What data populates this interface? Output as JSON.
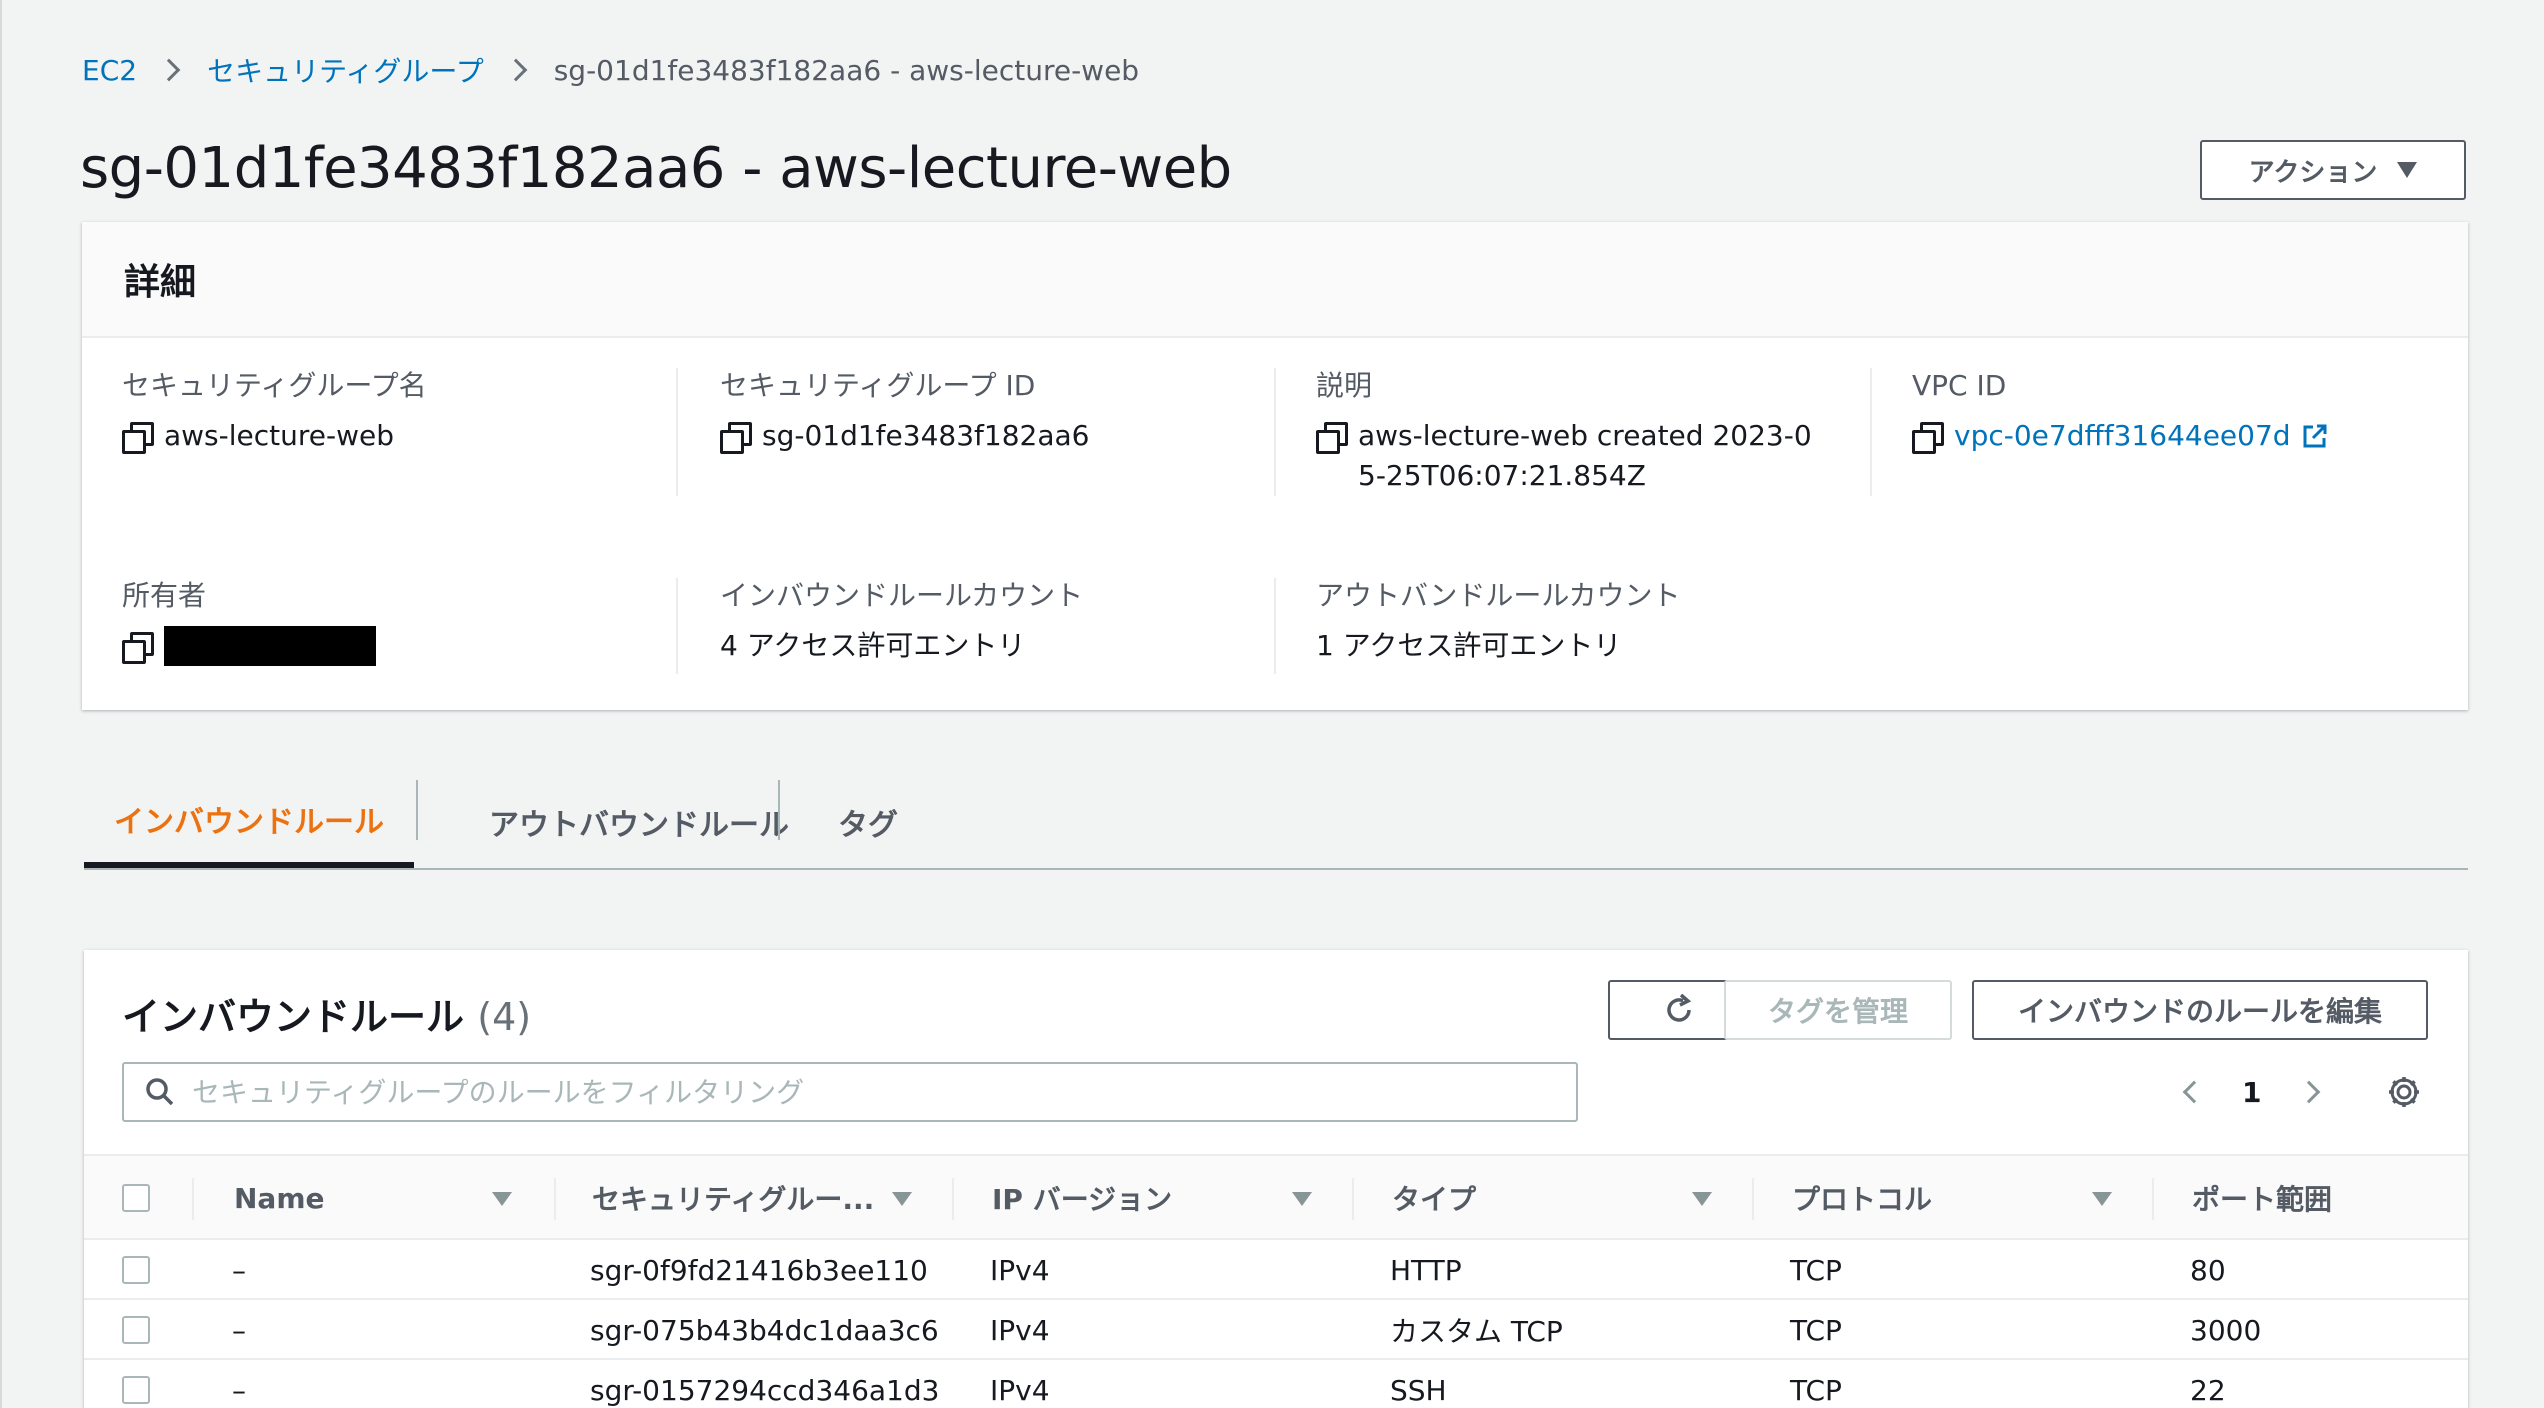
{
  "breadcrumb": {
    "items": [
      "EC2",
      "セキュリティグループ"
    ],
    "current": "sg-01d1fe3483f182aa6 - aws-lecture-web"
  },
  "page_title": "sg-01d1fe3483f182aa6 - aws-lecture-web",
  "action_button": "アクション",
  "details": {
    "header": "詳細",
    "fields": {
      "sg_name": {
        "label": "セキュリティグループ名",
        "value": "aws-lecture-web"
      },
      "sg_id": {
        "label": "セキュリティグループ ID",
        "value": "sg-01d1fe3483f182aa6"
      },
      "description": {
        "label": "説明",
        "value": "aws-lecture-web created 2023-05-25T06:07:21.854Z"
      },
      "vpc_id": {
        "label": "VPC ID",
        "value": "vpc-0e7dfff31644ee07d"
      },
      "owner": {
        "label": "所有者"
      },
      "inbound_count": {
        "label": "インバウンドルールカウント",
        "value": "4 アクセス許可エントリ"
      },
      "outbound_count": {
        "label": "アウトバンドルールカウント",
        "value": "1 アクセス許可エントリ"
      }
    }
  },
  "tabs": [
    {
      "label": "インバウンドルール",
      "active": true
    },
    {
      "label": "アウトバウンドルール",
      "active": false
    },
    {
      "label": "タグ",
      "active": false
    }
  ],
  "inbound": {
    "title": "インバウンドルール",
    "count": "(4)",
    "buttons": {
      "manage_tags": "タグを管理",
      "edit_rules": "インバウンドのルールを編集"
    },
    "search_placeholder": "セキュリティグループのルールをフィルタリング",
    "page": "1",
    "columns": [
      "Name",
      "セキュリティグルー...",
      "IP バージョン",
      "タイプ",
      "プロトコル",
      "ポート範囲"
    ],
    "rows": [
      {
        "name": "–",
        "rule_id": "sgr-0f9fd21416b3ee110",
        "ip_version": "IPv4",
        "type": "HTTP",
        "protocol": "TCP",
        "port": "80"
      },
      {
        "name": "–",
        "rule_id": "sgr-075b43b4dc1daa3c6",
        "ip_version": "IPv4",
        "type": "カスタム TCP",
        "protocol": "TCP",
        "port": "3000"
      },
      {
        "name": "–",
        "rule_id": "sgr-0157294ccd346a1d3",
        "ip_version": "IPv4",
        "type": "SSH",
        "protocol": "TCP",
        "port": "22"
      }
    ]
  },
  "colors": {
    "link": "#0073bb",
    "active_tab": "#ec7211",
    "background": "#f2f3f3"
  },
  "icons": [
    "copy-icon",
    "external-link-icon",
    "refresh-icon",
    "search-icon",
    "settings-icon",
    "chevron-left-icon",
    "chevron-right-icon",
    "sort-icon",
    "caret-down-icon"
  ]
}
